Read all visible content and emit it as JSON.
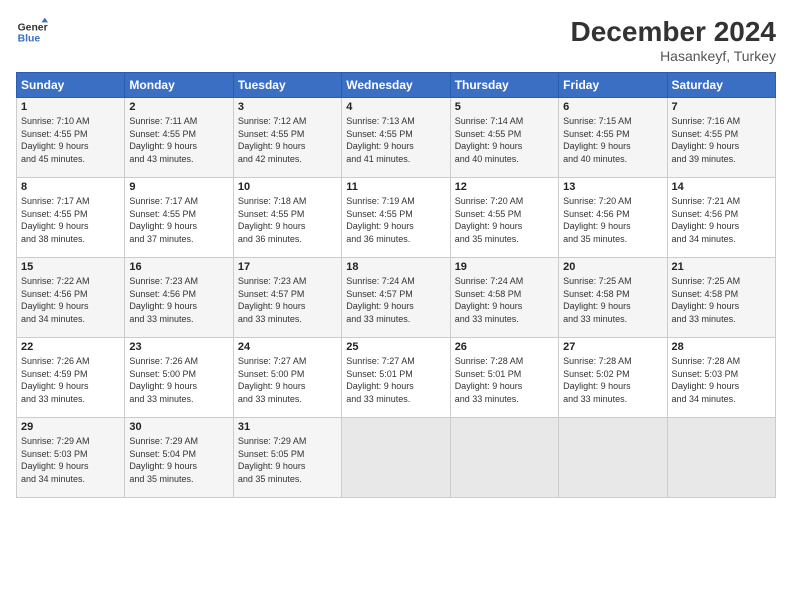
{
  "header": {
    "logo_line1": "General",
    "logo_line2": "Blue",
    "month": "December 2024",
    "location": "Hasankeyf, Turkey"
  },
  "weekdays": [
    "Sunday",
    "Monday",
    "Tuesday",
    "Wednesday",
    "Thursday",
    "Friday",
    "Saturday"
  ],
  "weeks": [
    [
      {
        "day": "1",
        "sunrise": "7:10 AM",
        "sunset": "4:55 PM",
        "daylight": "9 hours and 45 minutes."
      },
      {
        "day": "2",
        "sunrise": "7:11 AM",
        "sunset": "4:55 PM",
        "daylight": "9 hours and 43 minutes."
      },
      {
        "day": "3",
        "sunrise": "7:12 AM",
        "sunset": "4:55 PM",
        "daylight": "9 hours and 42 minutes."
      },
      {
        "day": "4",
        "sunrise": "7:13 AM",
        "sunset": "4:55 PM",
        "daylight": "9 hours and 41 minutes."
      },
      {
        "day": "5",
        "sunrise": "7:14 AM",
        "sunset": "4:55 PM",
        "daylight": "9 hours and 40 minutes."
      },
      {
        "day": "6",
        "sunrise": "7:15 AM",
        "sunset": "4:55 PM",
        "daylight": "9 hours and 40 minutes."
      },
      {
        "day": "7",
        "sunrise": "7:16 AM",
        "sunset": "4:55 PM",
        "daylight": "9 hours and 39 minutes."
      }
    ],
    [
      {
        "day": "8",
        "sunrise": "7:17 AM",
        "sunset": "4:55 PM",
        "daylight": "9 hours and 38 minutes."
      },
      {
        "day": "9",
        "sunrise": "7:17 AM",
        "sunset": "4:55 PM",
        "daylight": "9 hours and 37 minutes."
      },
      {
        "day": "10",
        "sunrise": "7:18 AM",
        "sunset": "4:55 PM",
        "daylight": "9 hours and 36 minutes."
      },
      {
        "day": "11",
        "sunrise": "7:19 AM",
        "sunset": "4:55 PM",
        "daylight": "9 hours and 36 minutes."
      },
      {
        "day": "12",
        "sunrise": "7:20 AM",
        "sunset": "4:55 PM",
        "daylight": "9 hours and 35 minutes."
      },
      {
        "day": "13",
        "sunrise": "7:20 AM",
        "sunset": "4:56 PM",
        "daylight": "9 hours and 35 minutes."
      },
      {
        "day": "14",
        "sunrise": "7:21 AM",
        "sunset": "4:56 PM",
        "daylight": "9 hours and 34 minutes."
      }
    ],
    [
      {
        "day": "15",
        "sunrise": "7:22 AM",
        "sunset": "4:56 PM",
        "daylight": "9 hours and 34 minutes."
      },
      {
        "day": "16",
        "sunrise": "7:23 AM",
        "sunset": "4:56 PM",
        "daylight": "9 hours and 33 minutes."
      },
      {
        "day": "17",
        "sunrise": "7:23 AM",
        "sunset": "4:57 PM",
        "daylight": "9 hours and 33 minutes."
      },
      {
        "day": "18",
        "sunrise": "7:24 AM",
        "sunset": "4:57 PM",
        "daylight": "9 hours and 33 minutes."
      },
      {
        "day": "19",
        "sunrise": "7:24 AM",
        "sunset": "4:58 PM",
        "daylight": "9 hours and 33 minutes."
      },
      {
        "day": "20",
        "sunrise": "7:25 AM",
        "sunset": "4:58 PM",
        "daylight": "9 hours and 33 minutes."
      },
      {
        "day": "21",
        "sunrise": "7:25 AM",
        "sunset": "4:58 PM",
        "daylight": "9 hours and 33 minutes."
      }
    ],
    [
      {
        "day": "22",
        "sunrise": "7:26 AM",
        "sunset": "4:59 PM",
        "daylight": "9 hours and 33 minutes."
      },
      {
        "day": "23",
        "sunrise": "7:26 AM",
        "sunset": "5:00 PM",
        "daylight": "9 hours and 33 minutes."
      },
      {
        "day": "24",
        "sunrise": "7:27 AM",
        "sunset": "5:00 PM",
        "daylight": "9 hours and 33 minutes."
      },
      {
        "day": "25",
        "sunrise": "7:27 AM",
        "sunset": "5:01 PM",
        "daylight": "9 hours and 33 minutes."
      },
      {
        "day": "26",
        "sunrise": "7:28 AM",
        "sunset": "5:01 PM",
        "daylight": "9 hours and 33 minutes."
      },
      {
        "day": "27",
        "sunrise": "7:28 AM",
        "sunset": "5:02 PM",
        "daylight": "9 hours and 33 minutes."
      },
      {
        "day": "28",
        "sunrise": "7:28 AM",
        "sunset": "5:03 PM",
        "daylight": "9 hours and 34 minutes."
      }
    ],
    [
      {
        "day": "29",
        "sunrise": "7:29 AM",
        "sunset": "5:03 PM",
        "daylight": "9 hours and 34 minutes."
      },
      {
        "day": "30",
        "sunrise": "7:29 AM",
        "sunset": "5:04 PM",
        "daylight": "9 hours and 35 minutes."
      },
      {
        "day": "31",
        "sunrise": "7:29 AM",
        "sunset": "5:05 PM",
        "daylight": "9 hours and 35 minutes."
      },
      null,
      null,
      null,
      null
    ]
  ]
}
